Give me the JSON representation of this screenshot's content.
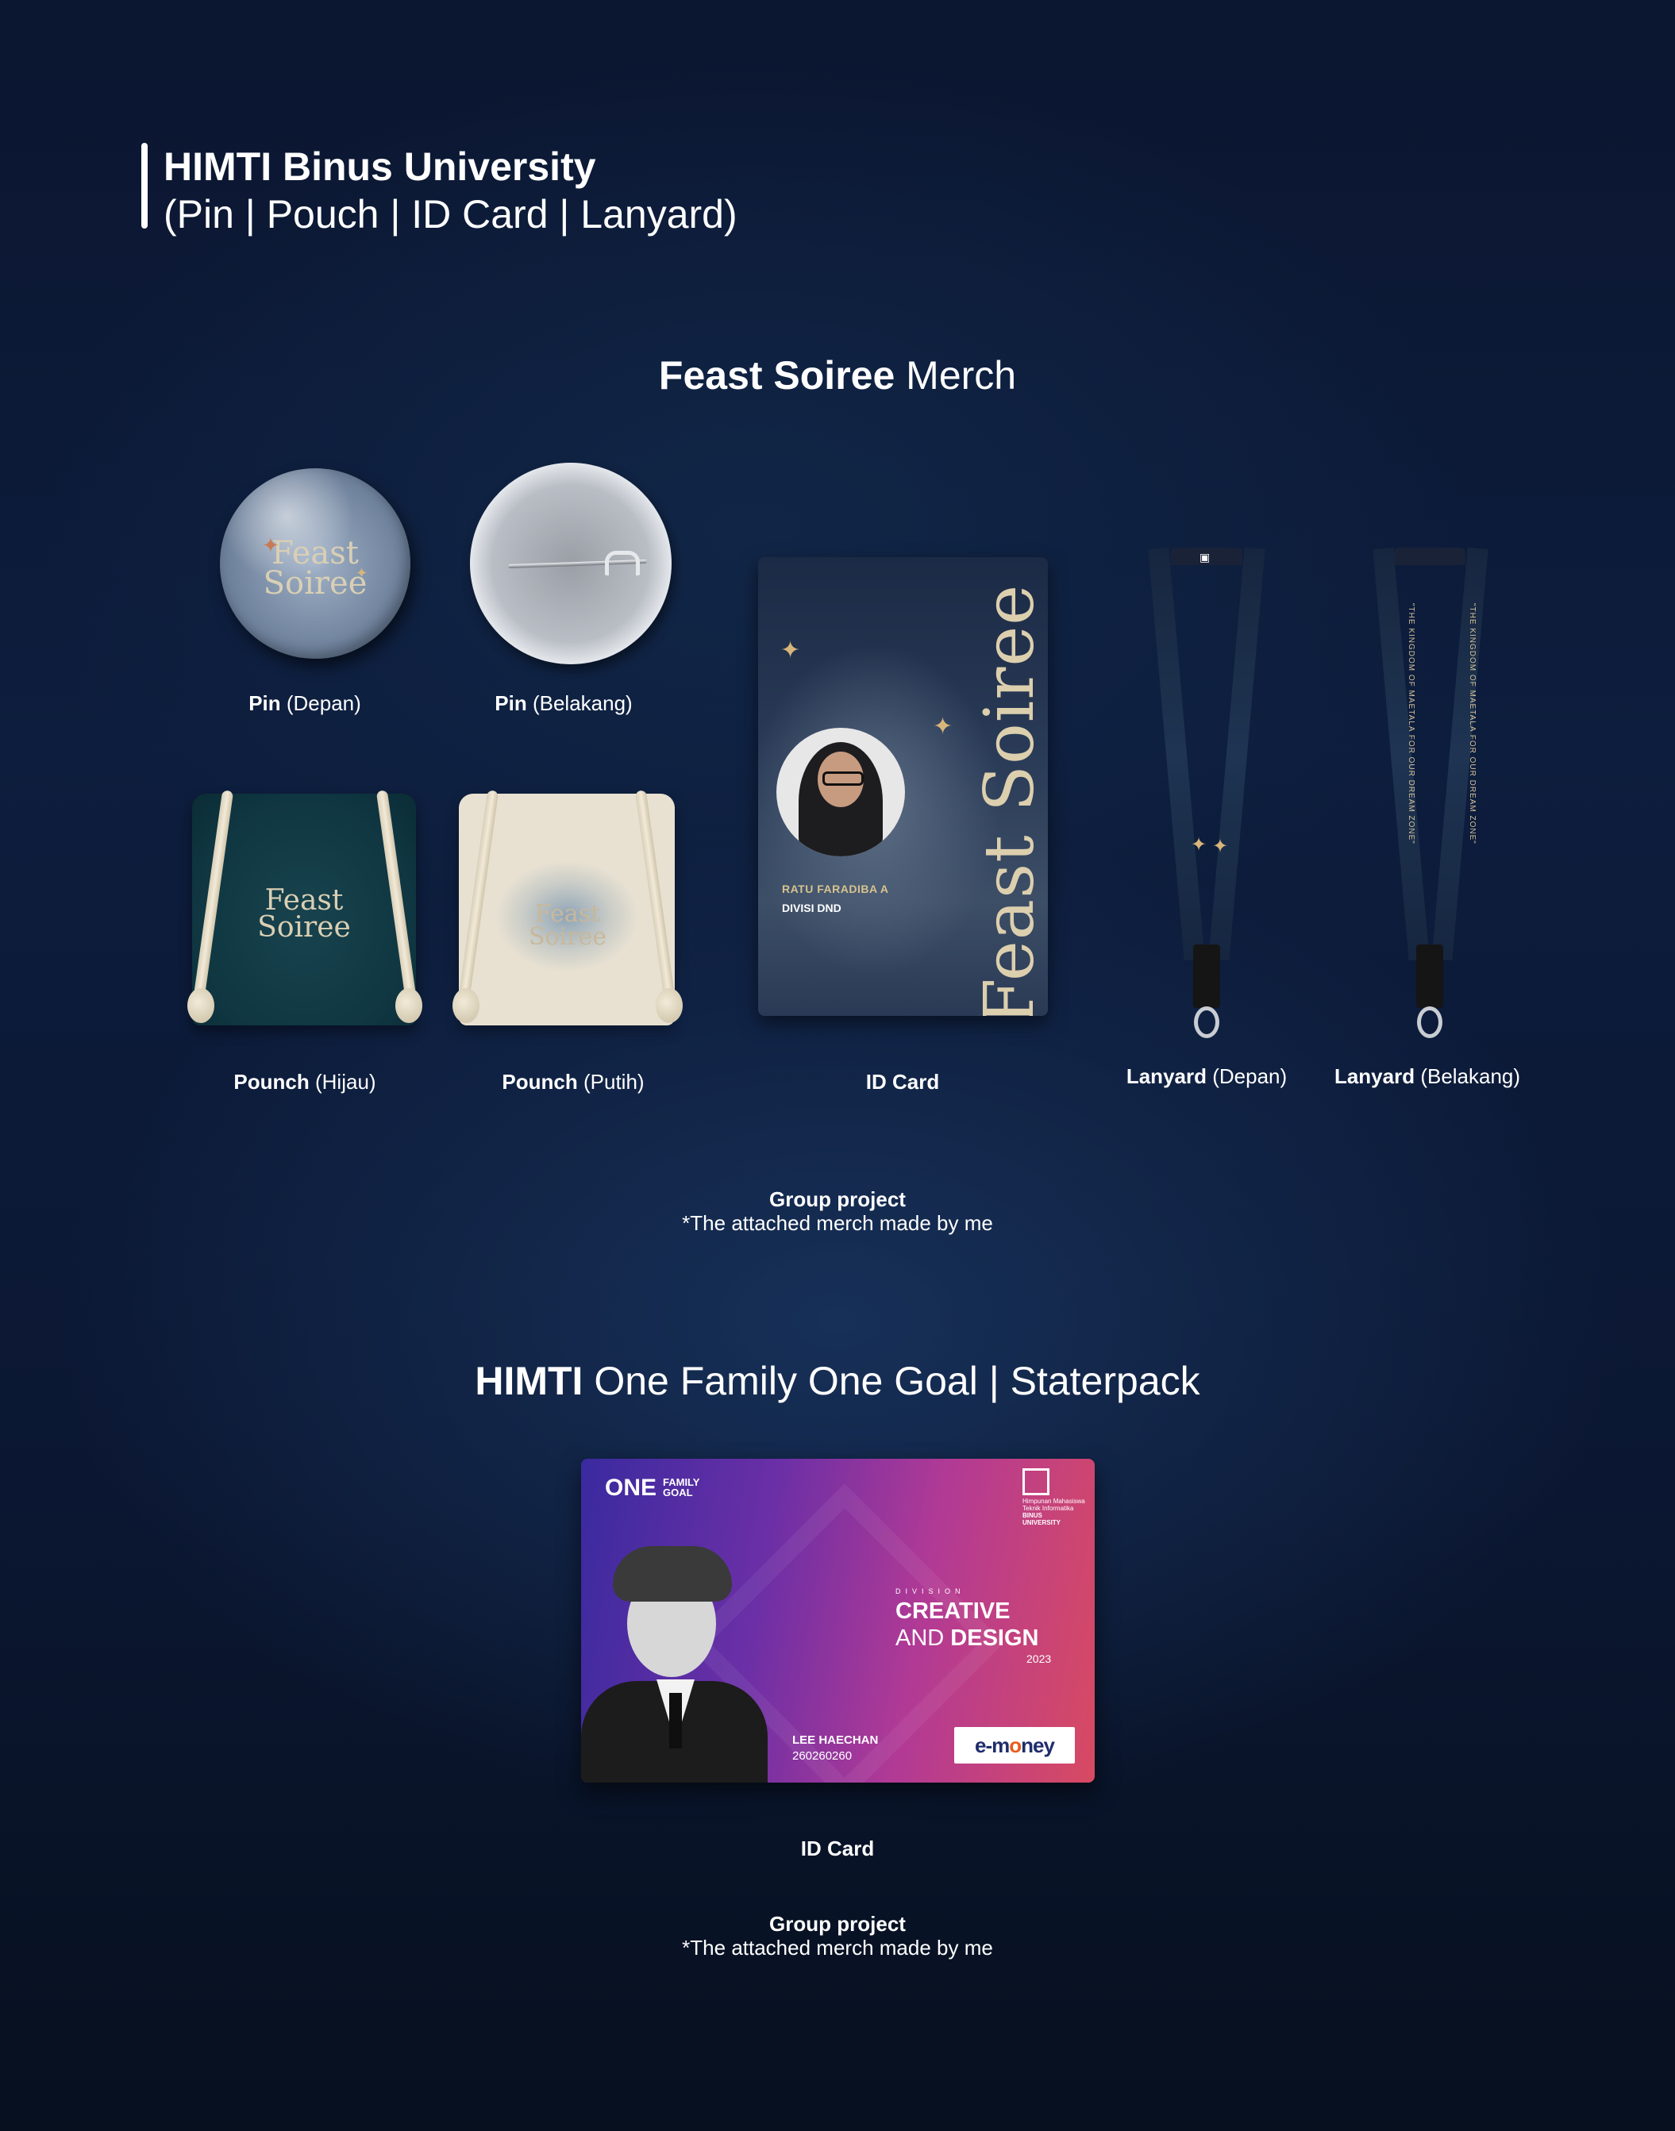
{
  "header": {
    "title": "HIMTI Binus University",
    "subtitle": "(Pin | Pouch | ID Card | Lanyard)"
  },
  "feast_section": {
    "title_bold": "Feast Soiree",
    "title_rest": " Merch",
    "logo_line1": "Feast",
    "logo_line2": "Soiree",
    "vertical_title": "Feast Soiree",
    "items": [
      {
        "bold": "Pin",
        "rest": " (Depan)"
      },
      {
        "bold": "Pin",
        "rest": " (Belakang)"
      },
      {
        "bold": "Pounch",
        "rest": " (Hijau)"
      },
      {
        "bold": "Pounch",
        "rest": " (Putih)"
      },
      {
        "bold": "ID Card",
        "rest": ""
      },
      {
        "bold": "Lanyard",
        "rest": " (Depan)"
      },
      {
        "bold": "Lanyard",
        "rest": " (Belakang)"
      }
    ],
    "id_card": {
      "name": "RATU FARADIBA A",
      "division": "DIVISI DND"
    },
    "lanyard_text": "\"THE KINGDOM OF MAETALA FOR OUR DREAM ZONE\"",
    "note_bold": "Group project",
    "note_text": "*The attached merch made by me"
  },
  "himti_section": {
    "title_bold": "HIMTI",
    "title_rest": " One Family One Goal | Staterpack",
    "card": {
      "one": "ONE",
      "family": "FAMILY",
      "goal": "GOAL",
      "org_line1": "Himpunan Mahasiswa",
      "org_line2": "Teknik Informatika",
      "binus_line1": "BINUS",
      "binus_line2": "UNIVERSITY",
      "division_label": "DIVISION",
      "creative": "CREATIVE",
      "and": "AND ",
      "design": "DESIGN",
      "year": "2023",
      "person_name": "LEE HAECHAN",
      "person_id": "260260260",
      "emoney_pre": "e-m",
      "emoney_o": "o",
      "emoney_post": "ney"
    },
    "caption": "ID Card",
    "note_bold": "Group project",
    "note_text": "*The attached merch made by me"
  }
}
